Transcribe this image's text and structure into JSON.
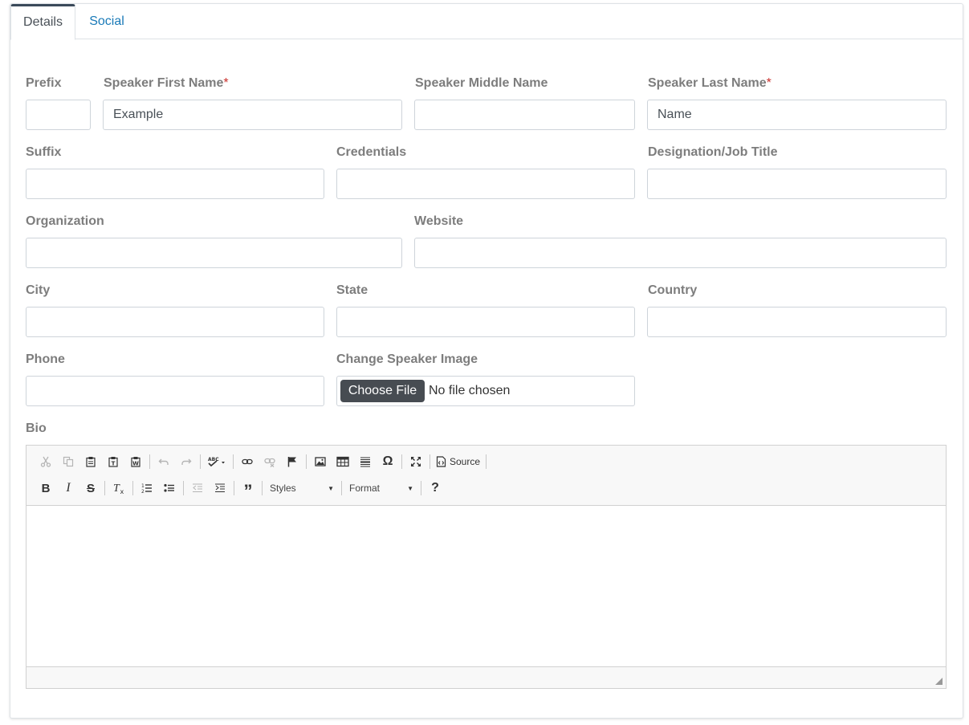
{
  "tabs": [
    {
      "label": "Details",
      "active": true
    },
    {
      "label": "Social",
      "active": false
    }
  ],
  "fields": {
    "prefix": {
      "label": "Prefix",
      "value": ""
    },
    "first_name": {
      "label": "Speaker First Name",
      "required_mark": "*",
      "value": "Example"
    },
    "middle_name": {
      "label": "Speaker Middle Name",
      "value": ""
    },
    "last_name": {
      "label": "Speaker Last Name",
      "required_mark": "*",
      "value": "Name"
    },
    "suffix": {
      "label": "Suffix",
      "value": ""
    },
    "credentials": {
      "label": "Credentials",
      "value": ""
    },
    "designation": {
      "label": "Designation/Job Title",
      "value": ""
    },
    "organization": {
      "label": "Organization",
      "value": ""
    },
    "website": {
      "label": "Website",
      "value": ""
    },
    "city": {
      "label": "City",
      "value": ""
    },
    "state": {
      "label": "State",
      "value": ""
    },
    "country": {
      "label": "Country",
      "value": ""
    },
    "phone": {
      "label": "Phone",
      "value": ""
    },
    "speaker_image": {
      "label": "Change Speaker Image",
      "button": "Choose File",
      "status": "No file chosen"
    },
    "bio": {
      "label": "Bio"
    }
  },
  "editor": {
    "source_label": "Source",
    "styles_label": "Styles",
    "format_label": "Format",
    "help_label": "?",
    "spell_label": "ABC",
    "icons_row1": [
      "cut-icon",
      "copy-icon",
      "paste-icon",
      "paste-text-icon",
      "paste-word-icon",
      "undo-icon",
      "redo-icon",
      "spellcheck-icon",
      "link-icon",
      "unlink-icon",
      "anchor-icon",
      "image-icon",
      "table-icon",
      "horizontal-line-icon",
      "special-char-icon",
      "maximize-icon",
      "source-icon"
    ],
    "icons_row2": [
      "bold-icon",
      "italic-icon",
      "strike-icon",
      "remove-format-icon",
      "numbered-list-icon",
      "bulleted-list-icon",
      "outdent-icon",
      "indent-icon",
      "blockquote-icon",
      "help-icon"
    ]
  },
  "colors": {
    "label": "#7d7d7d",
    "required": "#c9302c",
    "tab_link": "#1a7ab8",
    "file_button": "#474c52"
  }
}
